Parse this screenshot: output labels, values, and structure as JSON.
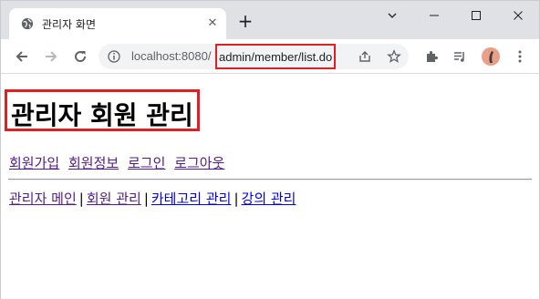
{
  "browser": {
    "tab": {
      "title": "관리자 화면",
      "favicon": "globe-icon"
    },
    "address": {
      "host": "localhost:8080/",
      "path": "admin/member/list.do"
    },
    "window_controls": [
      "minimize-icon",
      "maximize-icon",
      "close-icon"
    ]
  },
  "page": {
    "title": "관리자 회원 관리",
    "member_links": [
      "회원가입",
      "회원정보",
      "로그인",
      "로그아웃"
    ],
    "admin_links": [
      "관리자 메인",
      "회원 관리",
      "카테고리 관리",
      "강의 관리"
    ],
    "separator": "|"
  },
  "colors": {
    "highlight": "#e02020",
    "visited_link": "#551a8b",
    "link": "#0000ee"
  }
}
